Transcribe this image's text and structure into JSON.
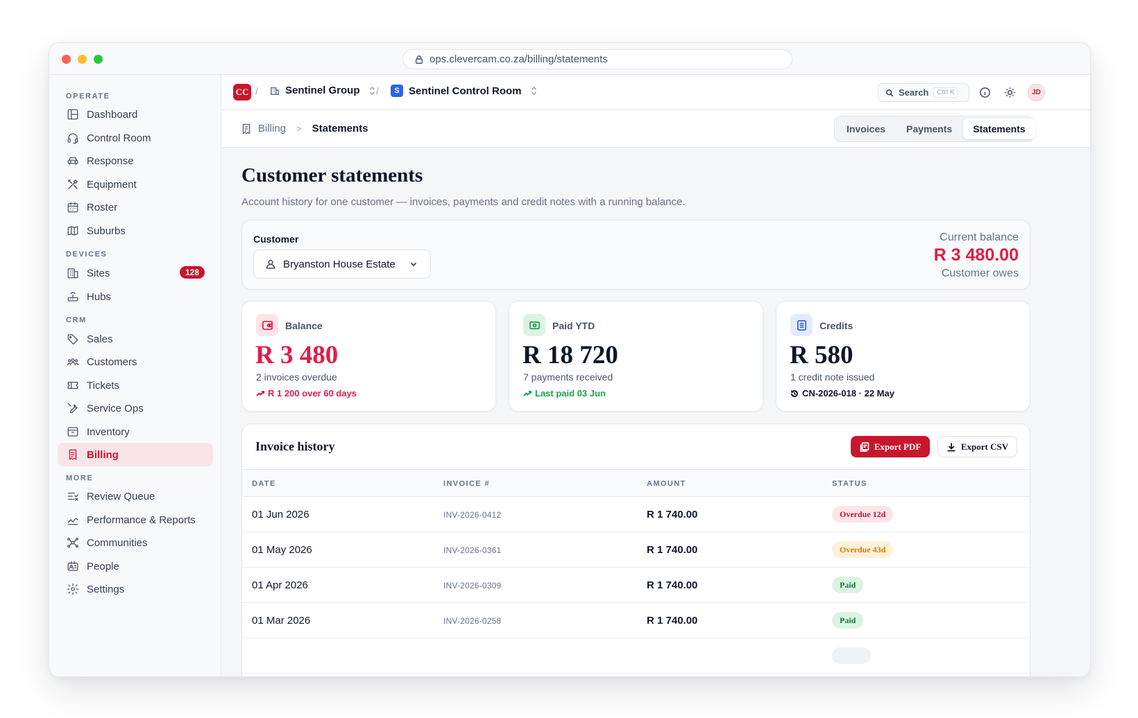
{
  "browser": {
    "url": "ops.clevercam.co.za/billing/statements"
  },
  "sidebar": {
    "sections": {
      "operate": "OPERATE",
      "devices": "DEVICES",
      "crm": "CRM",
      "more": "MORE"
    },
    "items": {
      "dashboard": "Dashboard",
      "control_room": "Control Room",
      "response": "Response",
      "equipment": "Equipment",
      "roster": "Roster",
      "suburbs": "Suburbs",
      "sites": "Sites",
      "sites_count": "128",
      "hubs": "Hubs",
      "sales": "Sales",
      "customers": "Customers",
      "tickets": "Tickets",
      "service_ops": "Service Ops",
      "inventory": "Inventory",
      "billing": "Billing",
      "review_queue": "Review Queue",
      "performance_reports": "Performance & Reports",
      "communities": "Communities",
      "people": "People",
      "settings": "Settings"
    }
  },
  "topbar": {
    "logo": "CC",
    "sep": "/",
    "org": "Sentinel Group",
    "workspace_badge": "S",
    "workspace": "Sentinel Control Room",
    "search_label": "Search",
    "search_shortcut": "Ctrl K",
    "avatar_initials": "JD"
  },
  "subbar": {
    "crumb_parent": "Billing",
    "crumb_sep": ">",
    "crumb_current": "Statements",
    "tabs": [
      "Invoices",
      "Payments",
      "Statements"
    ]
  },
  "page": {
    "title": "Customer statements",
    "subtitle": "Account history for one customer — invoices, payments and credit notes with a running balance."
  },
  "customer": {
    "label": "Customer",
    "selected": "Bryanston House Estate",
    "balance_label": "Current balance",
    "balance_value": "R 3 480.00",
    "balance_note": "Customer owes"
  },
  "stats": [
    {
      "label": "Balance",
      "value": "R 3 480",
      "sub": "2 invoices overdue",
      "trend": "R 1 200 over 60 days",
      "accent": "#e11d48"
    },
    {
      "label": "Paid YTD",
      "value": "R 18 720",
      "sub": "7 payments received",
      "trend": "Last paid 03 Jun",
      "accent": "#16a34a"
    },
    {
      "label": "Credits",
      "value": "R 580",
      "sub": "1 credit note issued",
      "trend": "CN-2026-018 · 22 May",
      "accent": "#0f172a"
    }
  ],
  "history": {
    "title": "Invoice history",
    "export_pdf": "Export PDF",
    "export_csv": "Export CSV",
    "columns": [
      "DATE",
      "INVOICE #",
      "AMOUNT",
      "STATUS"
    ],
    "rows": [
      {
        "date": "01 Jun 2026",
        "invoice": "INV-2026-0412",
        "amount": "R 1 740.00",
        "status": "Overdue 12d"
      },
      {
        "date": "01 May 2026",
        "invoice": "INV-2026-0361",
        "amount": "R 1 740.00",
        "status": "Overdue 43d"
      },
      {
        "date": "01 Apr 2026",
        "invoice": "INV-2026-0309",
        "amount": "R 1 740.00",
        "status": "Paid"
      },
      {
        "date": "01 Mar 2026",
        "invoice": "INV-2026-0258",
        "amount": "R 1 740.00",
        "status": "Paid"
      }
    ]
  },
  "colors": {
    "brand": "#c8162d",
    "danger": "#e11d48",
    "success": "#16a34a",
    "warning": "#d97706",
    "workspace": "#2f64e8"
  }
}
